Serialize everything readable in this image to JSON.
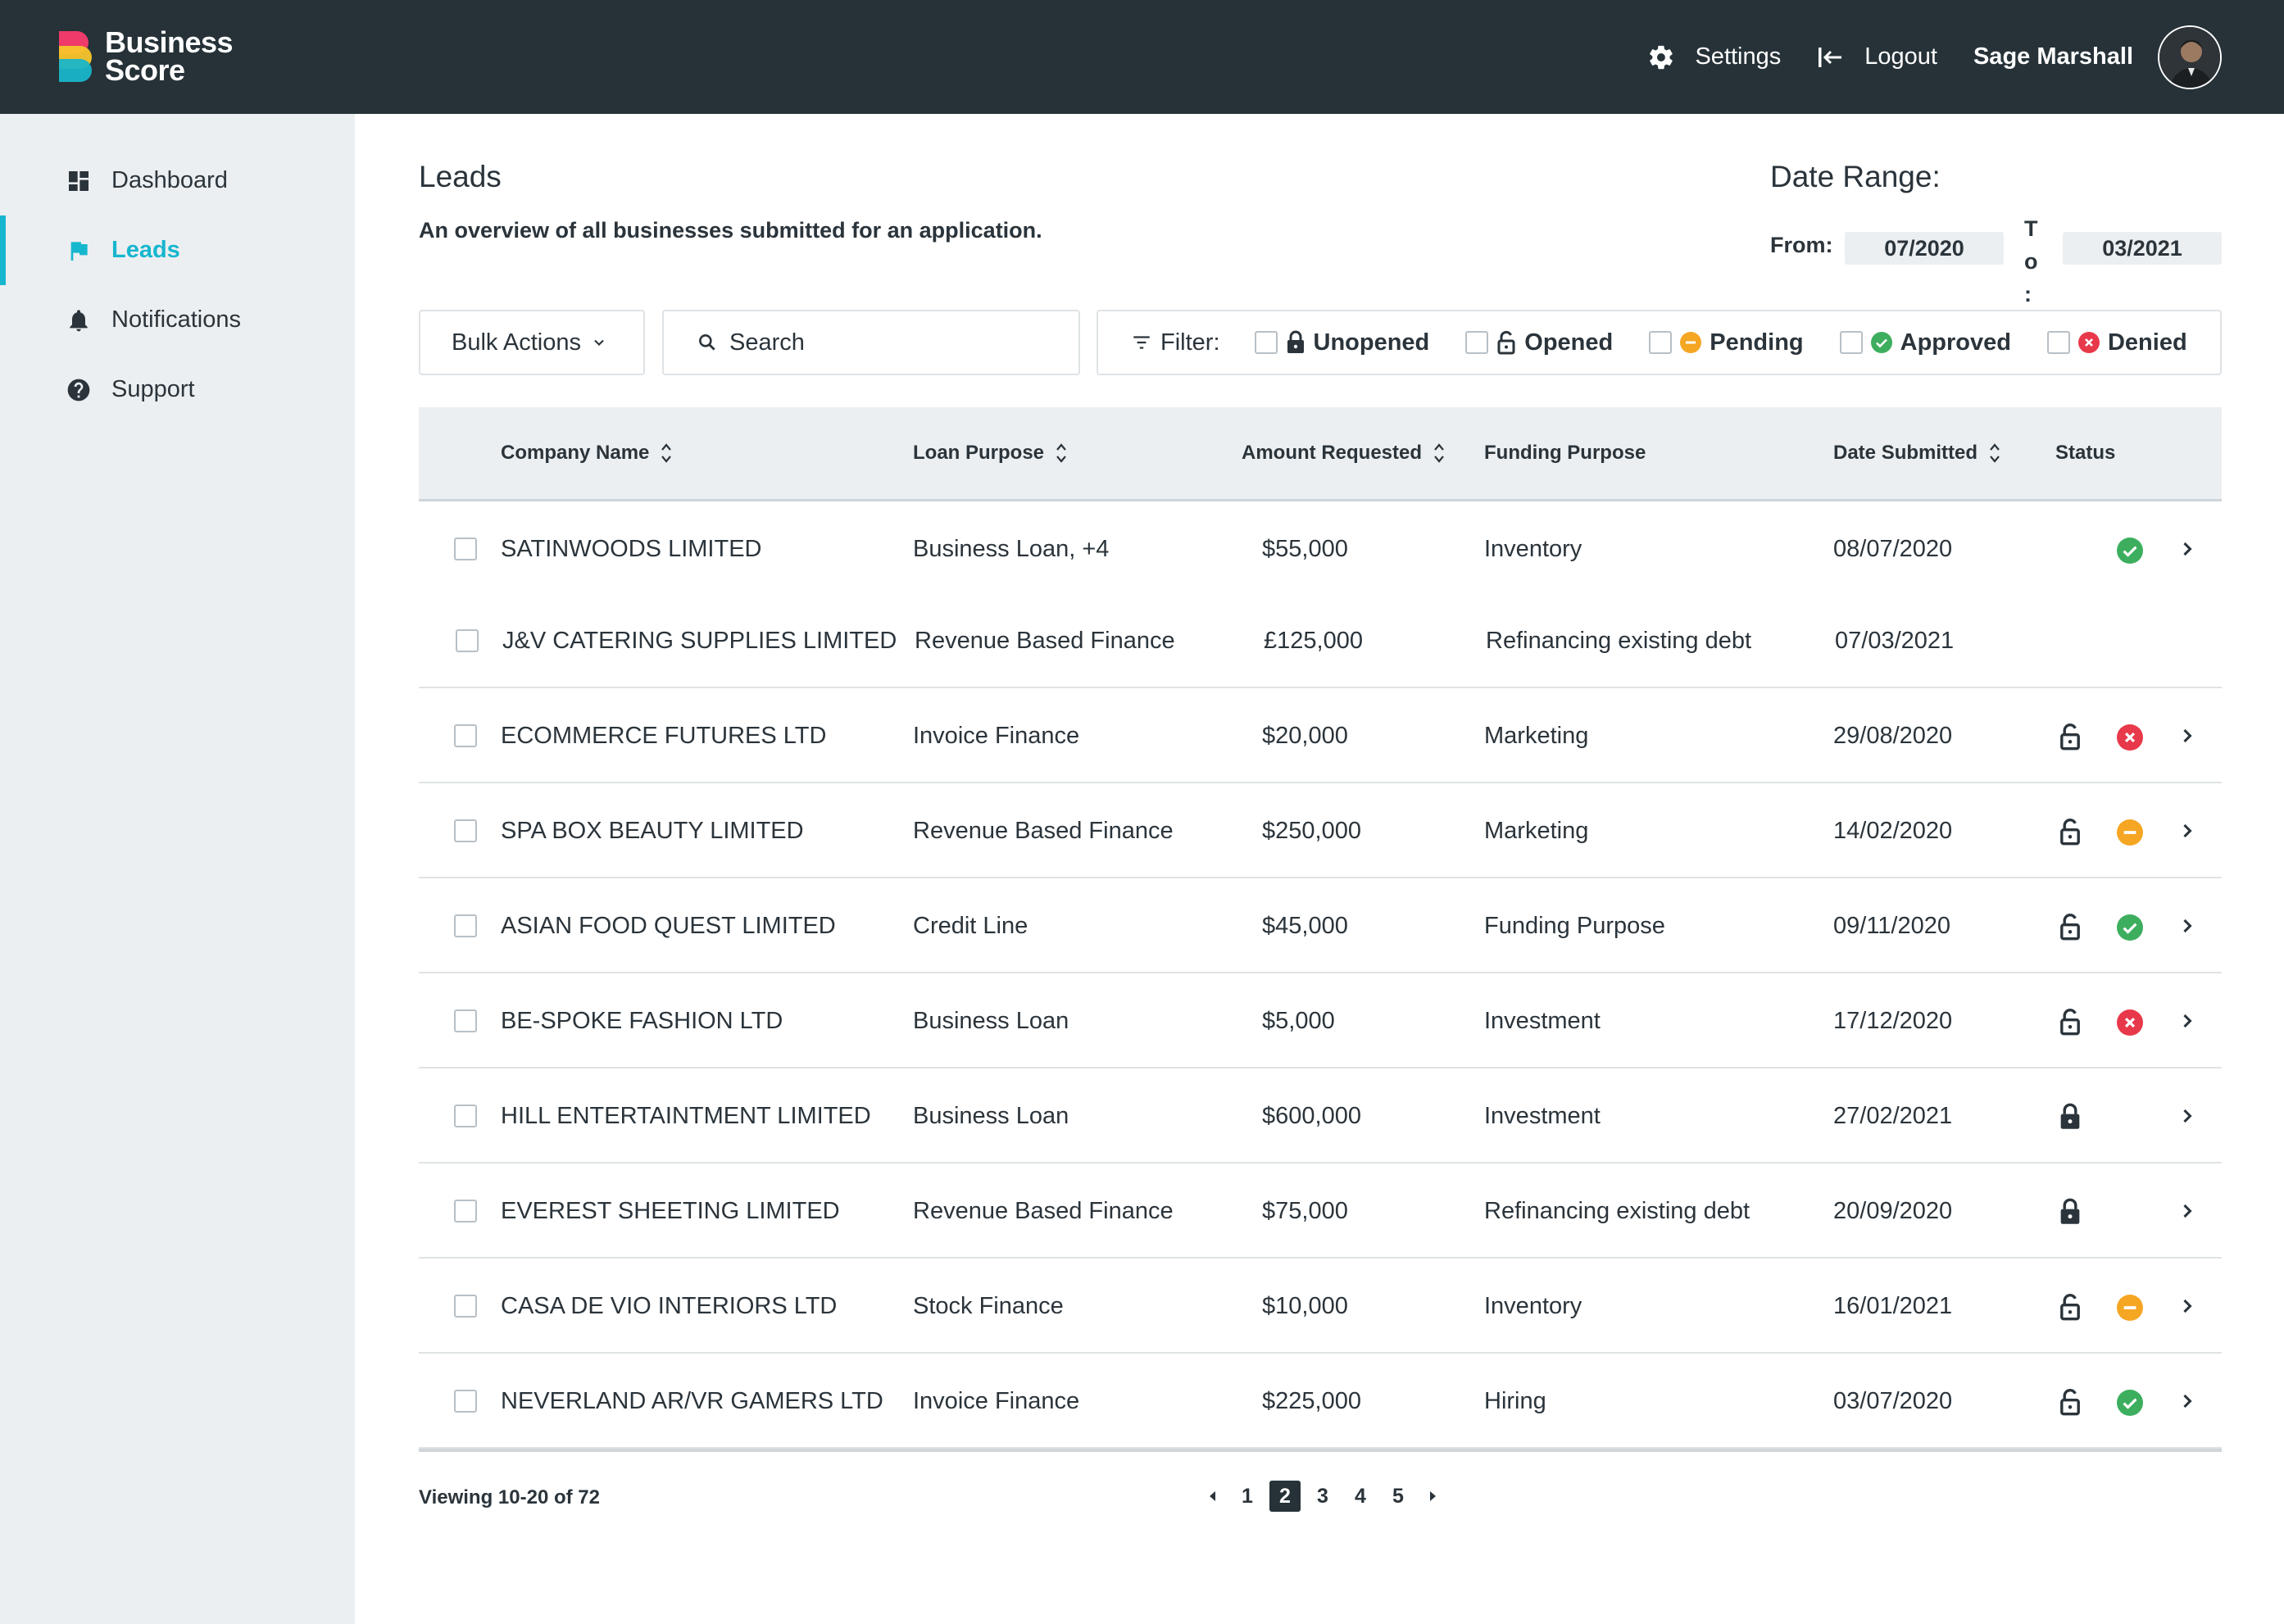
{
  "brand": {
    "line1": "Business",
    "line2": "Score"
  },
  "header": {
    "settings_label": "Settings",
    "logout_label": "Logout",
    "user_name": "Sage Marshall"
  },
  "sidebar": {
    "items": [
      {
        "label": "Dashboard",
        "icon": "dashboard-icon",
        "active": false
      },
      {
        "label": "Leads",
        "icon": "flag-icon",
        "active": true
      },
      {
        "label": "Notifications",
        "icon": "bell-icon",
        "active": false
      },
      {
        "label": "Support",
        "icon": "help-icon",
        "active": false
      }
    ]
  },
  "page": {
    "title": "Leads",
    "subtitle": "An overview of all businesses submitted for an application."
  },
  "date_range": {
    "title": "Date Range:",
    "from_label": "From:",
    "from_value": "07/2020",
    "to_label": "To :",
    "to_value": "03/2021"
  },
  "toolbar": {
    "bulk_actions_label": "Bulk Actions",
    "search_placeholder": "Search",
    "filter_label": "Filter:",
    "filters": [
      {
        "label": "Unopened",
        "icon": "lock-closed-icon"
      },
      {
        "label": "Opened",
        "icon": "lock-open-icon"
      },
      {
        "label": "Pending",
        "icon": "pending-icon"
      },
      {
        "label": "Approved",
        "icon": "approved-icon"
      },
      {
        "label": "Denied",
        "icon": "denied-icon"
      }
    ]
  },
  "table": {
    "columns": [
      "Company Name",
      "Loan Purpose",
      "Amount Requested",
      "Funding Purpose",
      "Date Submitted",
      "Status"
    ],
    "rows": [
      {
        "company": "SATINWOODS LIMITED",
        "loan": "Business Loan, +4",
        "amount": "$55,000",
        "funding": "Inventory",
        "date": "08/07/2020",
        "lock": "none",
        "status": "approved",
        "arrow": true
      },
      {
        "company": "J&V CATERING SUPPLIES LIMITED",
        "loan": "Revenue Based Finance",
        "amount": "£125,000",
        "funding": "Refinancing existing debt",
        "date": "07/03/2021",
        "lock": "none",
        "status": "none",
        "arrow": false
      },
      {
        "company": "ECOMMERCE FUTURES LTD",
        "loan": "Invoice Finance",
        "amount": "$20,000",
        "funding": "Marketing",
        "date": "29/08/2020",
        "lock": "open",
        "status": "denied",
        "arrow": true
      },
      {
        "company": "SPA BOX BEAUTY LIMITED",
        "loan": "Revenue Based Finance",
        "amount": "$250,000",
        "funding": "Marketing",
        "date": "14/02/2020",
        "lock": "open",
        "status": "pending",
        "arrow": true
      },
      {
        "company": "ASIAN FOOD QUEST LIMITED",
        "loan": "Credit Line",
        "amount": "$45,000",
        "funding": "Funding Purpose",
        "date": "09/11/2020",
        "lock": "open",
        "status": "approved",
        "arrow": true
      },
      {
        "company": "BE-SPOKE FASHION LTD",
        "loan": "Business Loan",
        "amount": "$5,000",
        "funding": "Investment",
        "date": "17/12/2020",
        "lock": "open",
        "status": "denied",
        "arrow": true
      },
      {
        "company": "HILL ENTERTAINTMENT LIMITED",
        "loan": "Business Loan",
        "amount": "$600,000",
        "funding": "Investment",
        "date": "27/02/2021",
        "lock": "closed",
        "status": "none",
        "arrow": true
      },
      {
        "company": "EVEREST SHEETING LIMITED",
        "loan": "Revenue Based Finance",
        "amount": "$75,000",
        "funding": "Refinancing existing debt",
        "date": "20/09/2020",
        "lock": "closed",
        "status": "none",
        "arrow": true
      },
      {
        "company": "CASA DE VIO INTERIORS LTD",
        "loan": "Stock Finance",
        "amount": "$10,000",
        "funding": "Inventory",
        "date": "16/01/2021",
        "lock": "open",
        "status": "pending",
        "arrow": true
      },
      {
        "company": "NEVERLAND AR/VR GAMERS LTD",
        "loan": "Invoice Finance",
        "amount": "$225,000",
        "funding": "Hiring",
        "date": "03/07/2020",
        "lock": "open",
        "status": "approved",
        "arrow": true
      }
    ]
  },
  "pagination": {
    "viewing": "Viewing 10-20 of 72",
    "pages": [
      "1",
      "2",
      "3",
      "4",
      "5"
    ],
    "current": "2"
  },
  "colors": {
    "accent": "#17b6cf",
    "topbar": "#263238",
    "sidebar": "#eceff1",
    "approved": "#3dae5e",
    "pending": "#f5a623",
    "denied": "#e8394a"
  }
}
